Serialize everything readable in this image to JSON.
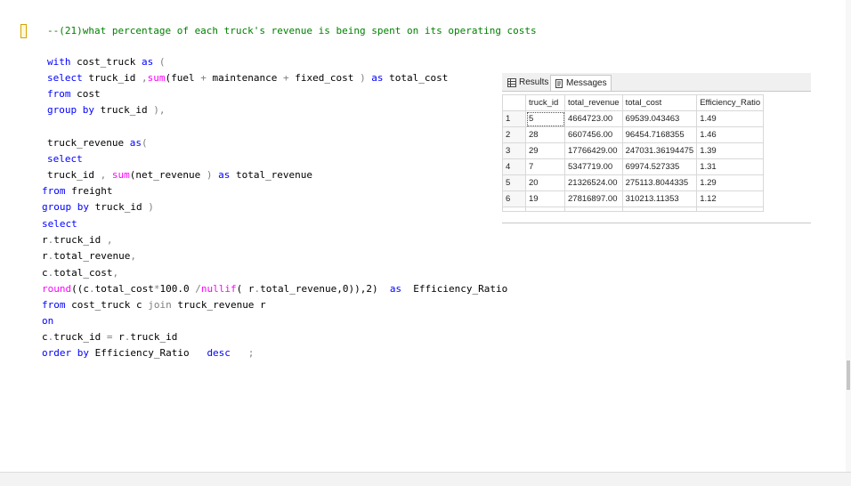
{
  "editor": {
    "comment": "--(21)what percentage of each truck's revenue is being spent on its operating costs",
    "line1_kw": "with",
    "line1_rest": " cost_truck ",
    "line1_as": "as",
    "line1_paren": " (",
    "line2_kw": "select",
    "line2_a": " truck_id ",
    "line2_comma": ",",
    "line2_fn": "sum",
    "line2_b": "(fuel ",
    "line2_plus1": "+",
    "line2_c": " maintenance ",
    "line2_plus2": "+",
    "line2_d": " fixed_cost ",
    "line2_close": ")",
    "line2_as": " as",
    "line2_e": " total_cost",
    "line3_kw": "from",
    "line3_rest": " cost",
    "line4_kw": "group by",
    "line4_rest": " truck_id ",
    "line4_end": "),",
    "line5_a": "truck_revenue ",
    "line5_as": "as",
    "line5_paren": "(",
    "line6_kw": "select",
    "line7_a": "truck_id ",
    "line7_comma": ",",
    "line7_fn": " sum",
    "line7_b": "(net_revenue ",
    "line7_close": ")",
    "line7_as": " as",
    "line7_c": " total_revenue",
    "line8_kw": "from",
    "line8_rest": " freight",
    "line9_kw": "group by",
    "line9_rest": " truck_id ",
    "line9_close": ")",
    "line10_kw": "select",
    "line11_a": "r",
    "line11_dot": ".",
    "line11_b": "truck_id ",
    "line11_comma": ",",
    "line12_a": "r",
    "line12_dot": ".",
    "line12_b": "total_revenue",
    "line12_comma": ",",
    "line13_a": "c",
    "line13_dot": ".",
    "line13_b": "total_cost",
    "line13_comma": ",",
    "line14_fn": "round",
    "line14_a": "((c",
    "line14_dot": ".",
    "line14_b": "total_cost",
    "line14_star": "*",
    "line14_c": "100.0 ",
    "line14_slash": "/",
    "line14_fn2": "nullif",
    "line14_d": "( r",
    "line14_dot2": ".",
    "line14_e": "total_revenue,0)),2)  ",
    "line14_as": "as",
    "line14_f": "  Efficiency_Ratio",
    "line15_kw": "from",
    "line15_a": " cost_truck c ",
    "line15_join": "join",
    "line15_b": " truck_revenue r",
    "line16_kw": "on",
    "line17_a": "c",
    "line17_dot": ".",
    "line17_b": "truck_id ",
    "line17_eq": "=",
    "line17_c": " r",
    "line17_dot2": ".",
    "line17_d": "truck_id",
    "line18_kw": "order by",
    "line18_a": " Efficiency_Ratio   ",
    "line18_desc": "desc",
    "line18_semi": "   ;"
  },
  "results": {
    "tab_results": "Results",
    "tab_messages": "Messages",
    "columns": [
      "truck_id",
      "total_revenue",
      "total_cost",
      "Efficiency_Ratio"
    ],
    "rows": [
      {
        "n": "1",
        "truck_id": "5",
        "total_revenue": "4664723.00",
        "total_cost": "69539.043463",
        "ratio": "1.49"
      },
      {
        "n": "2",
        "truck_id": "28",
        "total_revenue": "6607456.00",
        "total_cost": "96454.7168355",
        "ratio": "1.46"
      },
      {
        "n": "3",
        "truck_id": "29",
        "total_revenue": "17766429.00",
        "total_cost": "247031.36194475",
        "ratio": "1.39"
      },
      {
        "n": "4",
        "truck_id": "7",
        "total_revenue": "5347719.00",
        "total_cost": "69974.527335",
        "ratio": "1.31"
      },
      {
        "n": "5",
        "truck_id": "20",
        "total_revenue": "21326524.00",
        "total_cost": "275113.8044335",
        "ratio": "1.29"
      },
      {
        "n": "6",
        "truck_id": "19",
        "total_revenue": "27816897.00",
        "total_cost": "310213.11353",
        "ratio": "1.12"
      }
    ]
  }
}
